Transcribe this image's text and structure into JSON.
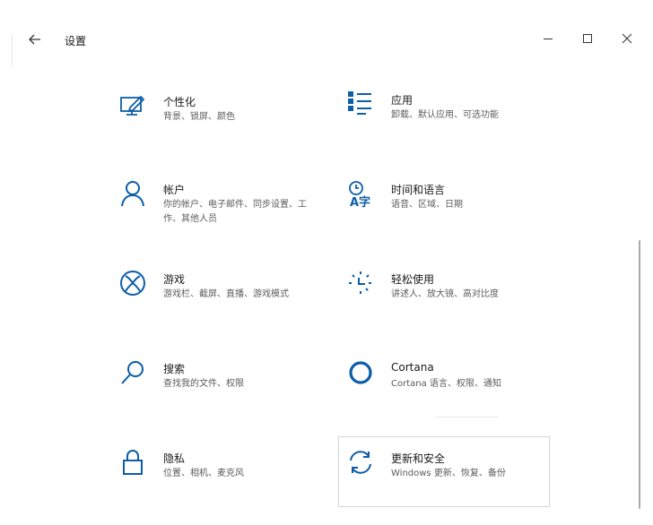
{
  "window": {
    "title": "设置",
    "back_icon": "back-arrow-icon",
    "controls": [
      "minimize-icon",
      "maximize-icon",
      "close-icon"
    ]
  },
  "accent_color": "#0c5ea8",
  "categories": [
    {
      "name": "个性化",
      "desc": "背景、锁屏、颜色",
      "icon": "personalization-icon"
    },
    {
      "name": "应用",
      "desc": "卸载、默认应用、可选功能",
      "icon": "apps-icon"
    },
    {
      "name": "帐户",
      "desc": "你的帐户、电子邮件、同步设置、工作、其他人员",
      "icon": "account-icon"
    },
    {
      "name": "时间和语言",
      "desc": "语音、区域、日期",
      "icon": "time-language-icon"
    },
    {
      "name": "游戏",
      "desc": "游戏栏、截屏、直播、游戏模式",
      "icon": "gaming-icon"
    },
    {
      "name": "轻松使用",
      "desc": "讲述人、放大镜、高对比度",
      "icon": "ease-of-access-icon"
    },
    {
      "name": "搜索",
      "desc": "查找我的文件、权限",
      "icon": "search-icon"
    },
    {
      "name": "Cortana",
      "desc": "Cortana 语言、权限、通知",
      "icon": "cortana-icon"
    },
    {
      "name": "隐私",
      "desc": "位置、相机、麦克风",
      "icon": "privacy-lock-icon"
    },
    {
      "name": "更新和安全",
      "desc": "Windows 更新、恢复、备份",
      "icon": "update-sync-icon"
    }
  ]
}
